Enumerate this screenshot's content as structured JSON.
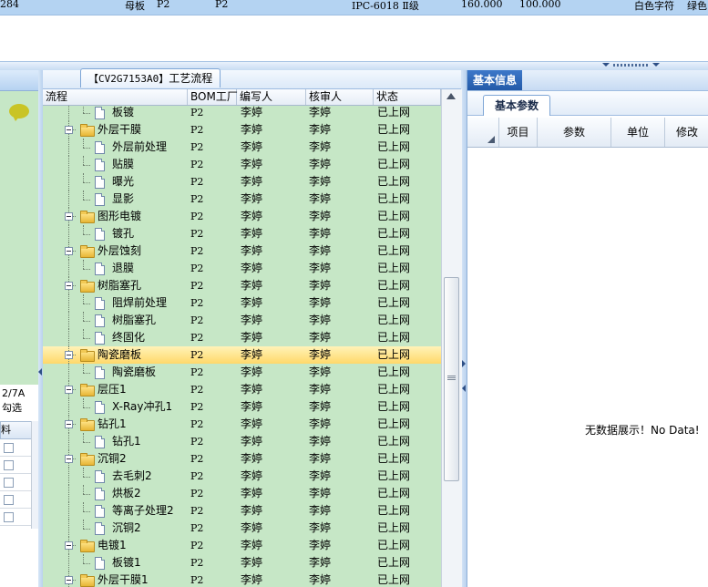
{
  "top_strip": {
    "cells": [
      "284",
      "母板",
      "P2",
      "P2",
      "IPC-6018 Ⅱ级",
      "160.000",
      "100.000",
      "白色字符",
      "绿色"
    ]
  },
  "left_panel": {
    "icon": "chat-bubble-icon",
    "label1": "2/7A",
    "label2": "勾选",
    "mini_header": "料"
  },
  "center": {
    "tab_code": "【CV2G7153A0】",
    "tab_title": "工艺流程",
    "columns": [
      "流程",
      "BOM工厂",
      "编写人",
      "核审人",
      "状态"
    ],
    "rows": [
      {
        "level": 2,
        "type": "doc",
        "name": "板镀",
        "bom": "P2",
        "writer": "李婷",
        "reviewer": "李婷",
        "status": "已上网"
      },
      {
        "level": 1,
        "type": "folder",
        "name": "外层干膜",
        "bom": "P2",
        "writer": "李婷",
        "reviewer": "李婷",
        "status": "已上网"
      },
      {
        "level": 2,
        "type": "doc",
        "name": "外层前处理",
        "bom": "P2",
        "writer": "李婷",
        "reviewer": "李婷",
        "status": "已上网"
      },
      {
        "level": 2,
        "type": "doc",
        "name": "贴膜",
        "bom": "P2",
        "writer": "李婷",
        "reviewer": "李婷",
        "status": "已上网"
      },
      {
        "level": 2,
        "type": "doc",
        "name": "曝光",
        "bom": "P2",
        "writer": "李婷",
        "reviewer": "李婷",
        "status": "已上网"
      },
      {
        "level": 2,
        "type": "doc",
        "name": "显影",
        "bom": "P2",
        "writer": "李婷",
        "reviewer": "李婷",
        "status": "已上网"
      },
      {
        "level": 1,
        "type": "folder",
        "name": "图形电镀",
        "bom": "P2",
        "writer": "李婷",
        "reviewer": "李婷",
        "status": "已上网"
      },
      {
        "level": 2,
        "type": "doc",
        "name": "镀孔",
        "bom": "P2",
        "writer": "李婷",
        "reviewer": "李婷",
        "status": "已上网"
      },
      {
        "level": 1,
        "type": "folder",
        "name": "外层蚀刻",
        "bom": "P2",
        "writer": "李婷",
        "reviewer": "李婷",
        "status": "已上网"
      },
      {
        "level": 2,
        "type": "doc",
        "name": "退膜",
        "bom": "P2",
        "writer": "李婷",
        "reviewer": "李婷",
        "status": "已上网"
      },
      {
        "level": 1,
        "type": "folder",
        "name": "树脂塞孔",
        "bom": "P2",
        "writer": "李婷",
        "reviewer": "李婷",
        "status": "已上网"
      },
      {
        "level": 2,
        "type": "doc",
        "name": "阻焊前处理",
        "bom": "P2",
        "writer": "李婷",
        "reviewer": "李婷",
        "status": "已上网"
      },
      {
        "level": 2,
        "type": "doc",
        "name": "树脂塞孔",
        "bom": "P2",
        "writer": "李婷",
        "reviewer": "李婷",
        "status": "已上网"
      },
      {
        "level": 2,
        "type": "doc",
        "name": "终固化",
        "bom": "P2",
        "writer": "李婷",
        "reviewer": "李婷",
        "status": "已上网"
      },
      {
        "level": 1,
        "type": "folder",
        "name": "陶瓷磨板",
        "bom": "P2",
        "writer": "李婷",
        "reviewer": "李婷",
        "status": "已上网",
        "selected": true
      },
      {
        "level": 2,
        "type": "doc",
        "name": "陶瓷磨板",
        "bom": "P2",
        "writer": "李婷",
        "reviewer": "李婷",
        "status": "已上网"
      },
      {
        "level": 1,
        "type": "folder",
        "name": "层压1",
        "bom": "P2",
        "writer": "李婷",
        "reviewer": "李婷",
        "status": "已上网"
      },
      {
        "level": 2,
        "type": "doc",
        "name": "X-Ray冲孔1",
        "bom": "P2",
        "writer": "李婷",
        "reviewer": "李婷",
        "status": "已上网"
      },
      {
        "level": 1,
        "type": "folder",
        "name": "钻孔1",
        "bom": "P2",
        "writer": "李婷",
        "reviewer": "李婷",
        "status": "已上网"
      },
      {
        "level": 2,
        "type": "doc",
        "name": "钻孔1",
        "bom": "P2",
        "writer": "李婷",
        "reviewer": "李婷",
        "status": "已上网"
      },
      {
        "level": 1,
        "type": "folder",
        "name": "沉铜2",
        "bom": "P2",
        "writer": "李婷",
        "reviewer": "李婷",
        "status": "已上网"
      },
      {
        "level": 2,
        "type": "doc",
        "name": "去毛刺2",
        "bom": "P2",
        "writer": "李婷",
        "reviewer": "李婷",
        "status": "已上网"
      },
      {
        "level": 2,
        "type": "doc",
        "name": "烘板2",
        "bom": "P2",
        "writer": "李婷",
        "reviewer": "李婷",
        "status": "已上网"
      },
      {
        "level": 2,
        "type": "doc",
        "name": "等离子处理2",
        "bom": "P2",
        "writer": "李婷",
        "reviewer": "李婷",
        "status": "已上网"
      },
      {
        "level": 2,
        "type": "doc",
        "name": "沉铜2",
        "bom": "P2",
        "writer": "李婷",
        "reviewer": "李婷",
        "status": "已上网"
      },
      {
        "level": 1,
        "type": "folder",
        "name": "电镀1",
        "bom": "P2",
        "writer": "李婷",
        "reviewer": "李婷",
        "status": "已上网"
      },
      {
        "level": 2,
        "type": "doc",
        "name": "板镀1",
        "bom": "P2",
        "writer": "李婷",
        "reviewer": "李婷",
        "status": "已上网"
      },
      {
        "level": 1,
        "type": "folder",
        "name": "外层干膜1",
        "bom": "P2",
        "writer": "李婷",
        "reviewer": "李婷",
        "status": "已上网"
      }
    ]
  },
  "right": {
    "panel_tab": "基本信息",
    "sub_tab": "基本参数",
    "columns": [
      "项目",
      "参数",
      "单位",
      "修改"
    ],
    "no_data": "无数据展示！No Data!"
  }
}
